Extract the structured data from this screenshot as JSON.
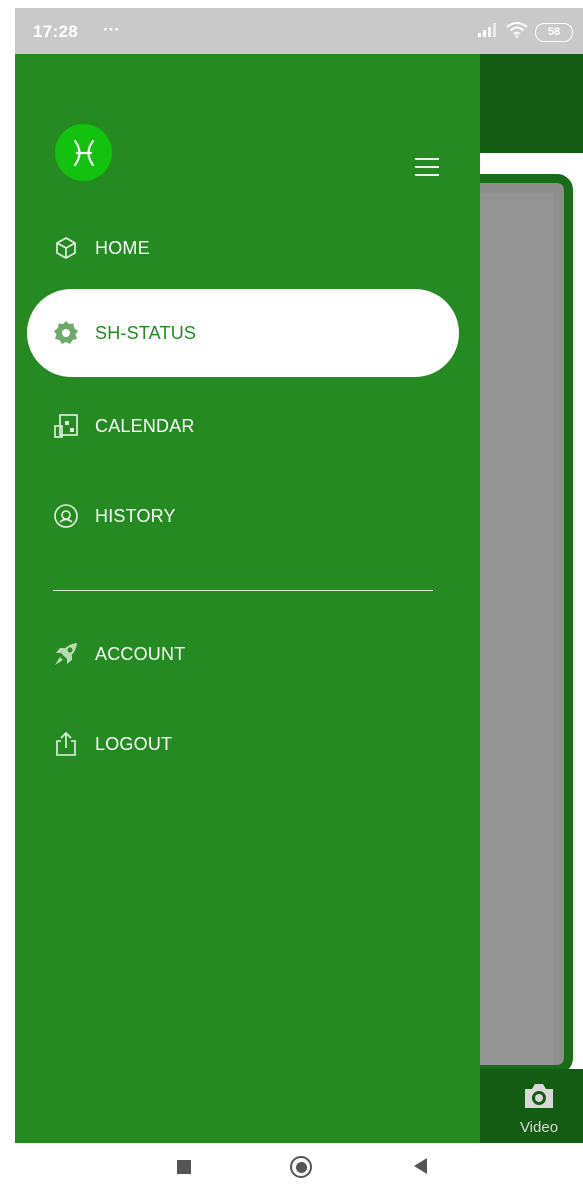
{
  "status_bar": {
    "time": "17:28",
    "dots": "···",
    "battery": "58",
    "signal_icon": "signal-icon",
    "wifi_icon": "wifi-icon"
  },
  "drawer": {
    "logo_glyph": "♓",
    "logo_icon": "pisces-logo-icon",
    "menu_icon": "hamburger-menu-icon",
    "items": [
      {
        "label": "HOME",
        "icon": "cube-icon",
        "active": false
      },
      {
        "label": "SH-STATUS",
        "icon": "gear-icon",
        "active": true
      },
      {
        "label": "CALENDAR",
        "icon": "calendar-icon",
        "active": false
      },
      {
        "label": "HISTORY",
        "icon": "history-icon",
        "active": false
      },
      {
        "label": "ACCOUNT",
        "icon": "rocket-icon",
        "active": false
      },
      {
        "label": "LOGOUT",
        "icon": "logout-icon",
        "active": false
      }
    ]
  },
  "background_app": {
    "video_label": "Video",
    "video_icon": "camera-icon"
  },
  "colors": {
    "drawer_bg": "#268a23",
    "logo_bg": "#12c20e",
    "header_bg": "#145c13",
    "active_item_bg": "#ffffff",
    "active_item_text": "#268a23"
  }
}
